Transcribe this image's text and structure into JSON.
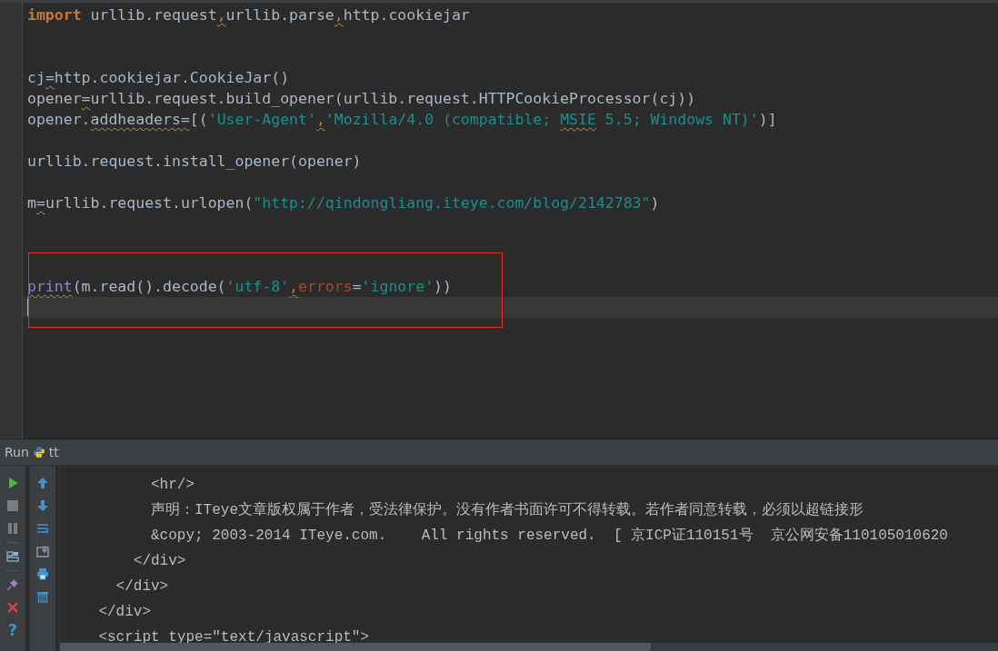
{
  "editor": {
    "lines": [
      {
        "current": false,
        "tokens": [
          {
            "text": "import",
            "kind": "keyword",
            "warn": false
          },
          {
            "text": " urllib.request",
            "kind": "plain",
            "warn": false
          },
          {
            "text": ",",
            "kind": "comma",
            "warn": true
          },
          {
            "text": "urllib.parse",
            "kind": "plain",
            "warn": false
          },
          {
            "text": ",",
            "kind": "comma",
            "warn": true
          },
          {
            "text": "http.cookiejar",
            "kind": "plain",
            "warn": false
          }
        ]
      },
      {
        "current": false
      },
      {
        "current": false
      },
      {
        "current": false,
        "tokens": [
          {
            "text": "cj",
            "kind": "plain",
            "warn": false
          },
          {
            "text": "=",
            "kind": "plain",
            "warn": true
          },
          {
            "text": "http.cookiejar.CookieJar()",
            "kind": "plain",
            "warn": false
          }
        ]
      },
      {
        "current": false,
        "tokens": [
          {
            "text": "opener",
            "kind": "plain",
            "warn": false
          },
          {
            "text": "=",
            "kind": "plain",
            "warn": true
          },
          {
            "text": "urllib.request.build_opener(urllib.request.HTTPCookieProcessor(cj))",
            "kind": "plain",
            "warn": false
          }
        ]
      },
      {
        "current": false,
        "tokens": [
          {
            "text": "opener.",
            "kind": "plain",
            "warn": false
          },
          {
            "text": "addheaders=",
            "kind": "plain",
            "warn": true
          },
          {
            "text": "[(",
            "kind": "plain",
            "warn": false
          },
          {
            "text": "'User-Agent'",
            "kind": "string",
            "warn": false
          },
          {
            "text": ",",
            "kind": "comma",
            "warn": true
          },
          {
            "text": "'Mozilla/4.0 (compatible; ",
            "kind": "string",
            "warn": false
          },
          {
            "text": "MSIE",
            "kind": "string",
            "warn": true
          },
          {
            "text": " 5.5; Windows NT)'",
            "kind": "string",
            "warn": false
          },
          {
            "text": ")]",
            "kind": "plain",
            "warn": false
          }
        ]
      },
      {
        "current": false
      },
      {
        "current": false,
        "tokens": [
          {
            "text": "urllib.request.install_opener(opener)",
            "kind": "plain",
            "warn": false
          }
        ]
      },
      {
        "current": false
      },
      {
        "current": false,
        "tokens": [
          {
            "text": "m",
            "kind": "plain",
            "warn": false
          },
          {
            "text": "=",
            "kind": "plain",
            "warn": true
          },
          {
            "text": "urllib.request.urlopen(",
            "kind": "plain",
            "warn": false
          },
          {
            "text": "\"http://qindongliang.iteye.com/blog/2142783\"",
            "kind": "string",
            "warn": false
          },
          {
            "text": ")",
            "kind": "plain",
            "warn": false
          }
        ]
      },
      {
        "current": false
      },
      {
        "current": false
      },
      {
        "current": false
      },
      {
        "current": false,
        "tokens": [
          {
            "text": "print",
            "kind": "builtin",
            "warn": true
          },
          {
            "text": "(m.read().decode(",
            "kind": "plain",
            "warn": false
          },
          {
            "text": "'utf-8'",
            "kind": "string",
            "warn": false
          },
          {
            "text": ",",
            "kind": "comma",
            "warn": true
          },
          {
            "text": "errors",
            "kind": "param",
            "warn": false
          },
          {
            "text": "=",
            "kind": "plain",
            "warn": false
          },
          {
            "text": "'ignore'",
            "kind": "string",
            "warn": false
          },
          {
            "text": "))",
            "kind": "plain",
            "warn": false
          }
        ]
      },
      {
        "current": true
      }
    ]
  },
  "run_panel": {
    "title": "Run",
    "config": "tt",
    "tools_left": [
      {
        "kind": "run"
      },
      {
        "kind": "stop"
      },
      {
        "kind": "pause"
      },
      {
        "kind": "layout"
      },
      {
        "kind": "pin"
      },
      {
        "kind": "close"
      },
      {
        "kind": "help",
        "glyph": "?"
      }
    ],
    "tools_right": [
      {
        "kind": "up"
      },
      {
        "kind": "down"
      },
      {
        "kind": "wrap"
      },
      {
        "kind": "scroll-end"
      },
      {
        "kind": "print"
      },
      {
        "kind": "trash"
      }
    ],
    "console_lines": [
      "          <hr/>",
      "          声明：ITeye文章版权属于作者，受法律保护。没有作者书面许可不得转载。若作者同意转载，必须以超链接形",
      "          &copy; 2003-2014 ITeye.com.    All rights reserved.  [ 京ICP证110151号  京公网安备110105010620",
      "        </div>",
      "      </div>",
      "    </div>",
      "    <script type=\"text/javascript\">"
    ]
  }
}
